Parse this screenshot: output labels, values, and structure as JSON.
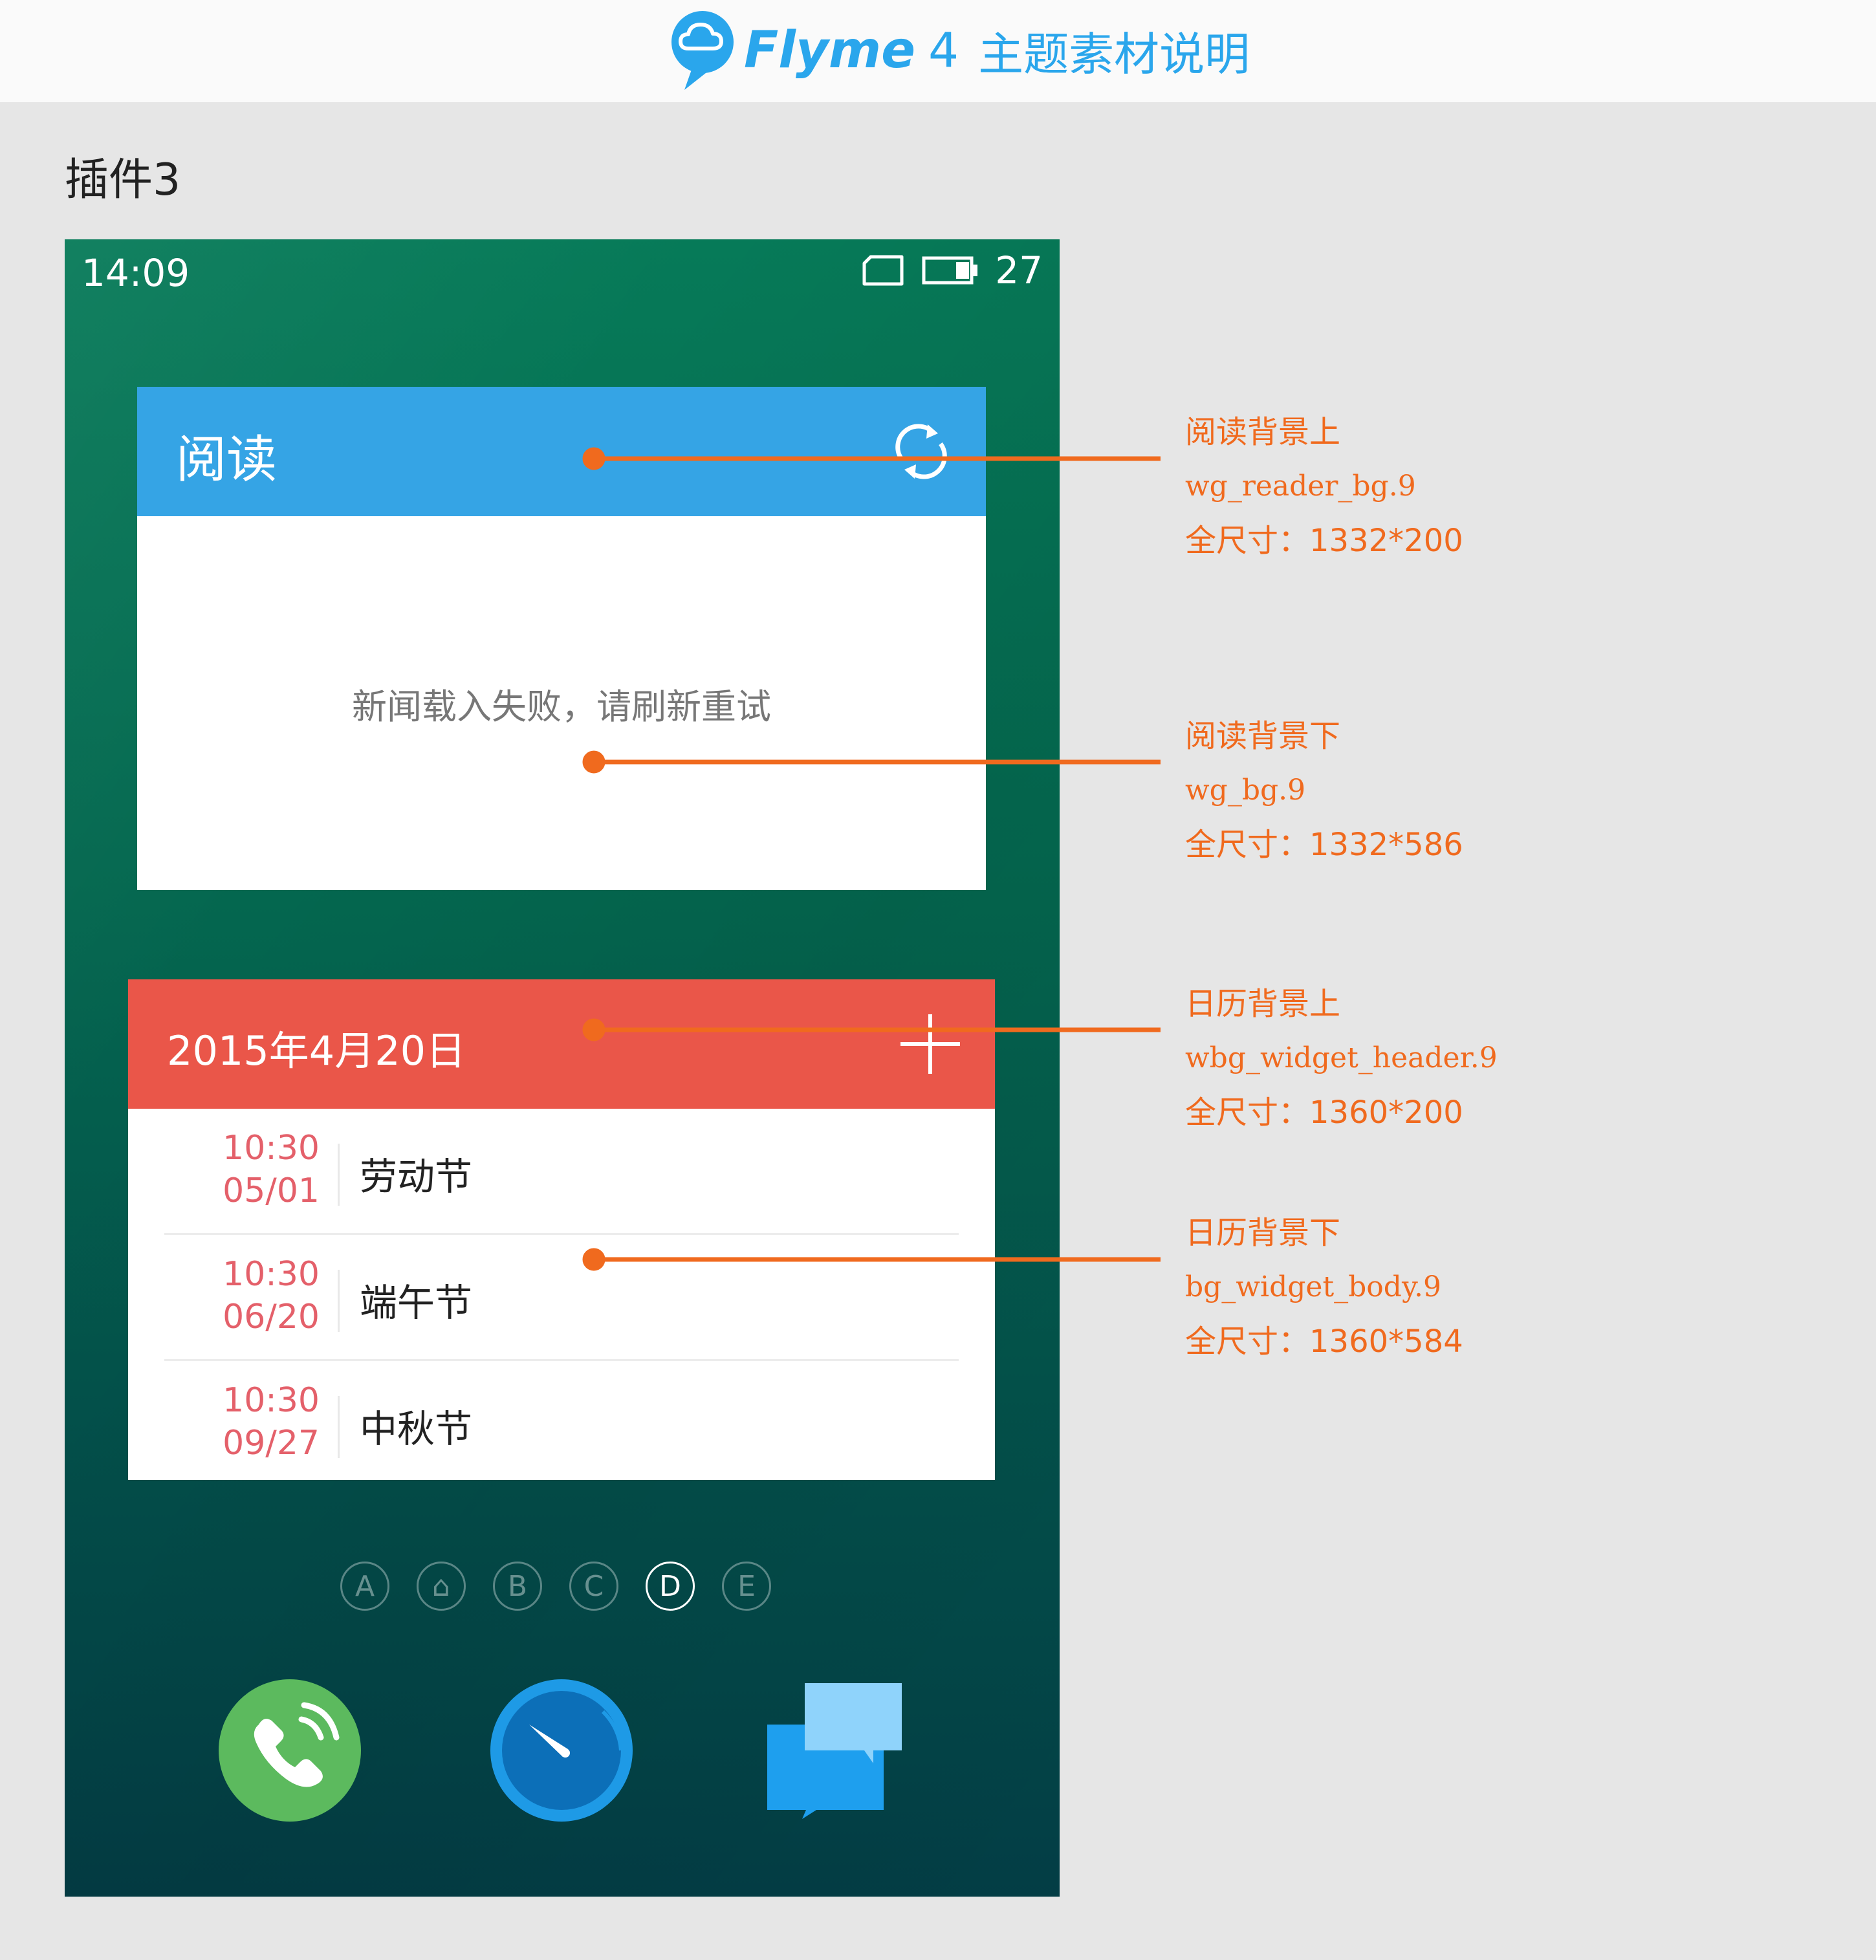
{
  "header": {
    "brand": "Flyme",
    "version": "4",
    "subtitle": "主题素材说明"
  },
  "section_title": "插件3",
  "status_bar": {
    "time": "14:09",
    "battery": "27"
  },
  "reader_widget": {
    "title": "阅读",
    "message": "新闻载入失败，请刷新重试"
  },
  "calendar_widget": {
    "date": "2015年4月20日",
    "events": [
      {
        "time": "10:30",
        "date": "05/01",
        "title": "劳动节"
      },
      {
        "time": "10:30",
        "date": "06/20",
        "title": "端午节"
      },
      {
        "time": "10:30",
        "date": "09/27",
        "title": "中秋节"
      }
    ]
  },
  "page_indicator": {
    "dots": [
      "A",
      "⌂",
      "B",
      "C",
      "D",
      "E"
    ],
    "active": "D"
  },
  "annotations": [
    {
      "label": "阅读背景上",
      "file": "wg_reader_bg.9",
      "size": "全尺寸：1332*200"
    },
    {
      "label": "阅读背景下",
      "file": "wg_bg.9",
      "size": "全尺寸：1332*586"
    },
    {
      "label": "日历背景上",
      "file": "wbg_widget_header.9",
      "size": "全尺寸：1360*200"
    },
    {
      "label": "日历背景下",
      "file": "bg_widget_body.9",
      "size": "全尺寸：1360*584"
    }
  ],
  "colors": {
    "brand_blue": "#2aa6ec",
    "reader_header": "#35a4e5",
    "calendar_header": "#ea5649",
    "annotation": "#f06a1e",
    "event_time": "#e4606a"
  }
}
